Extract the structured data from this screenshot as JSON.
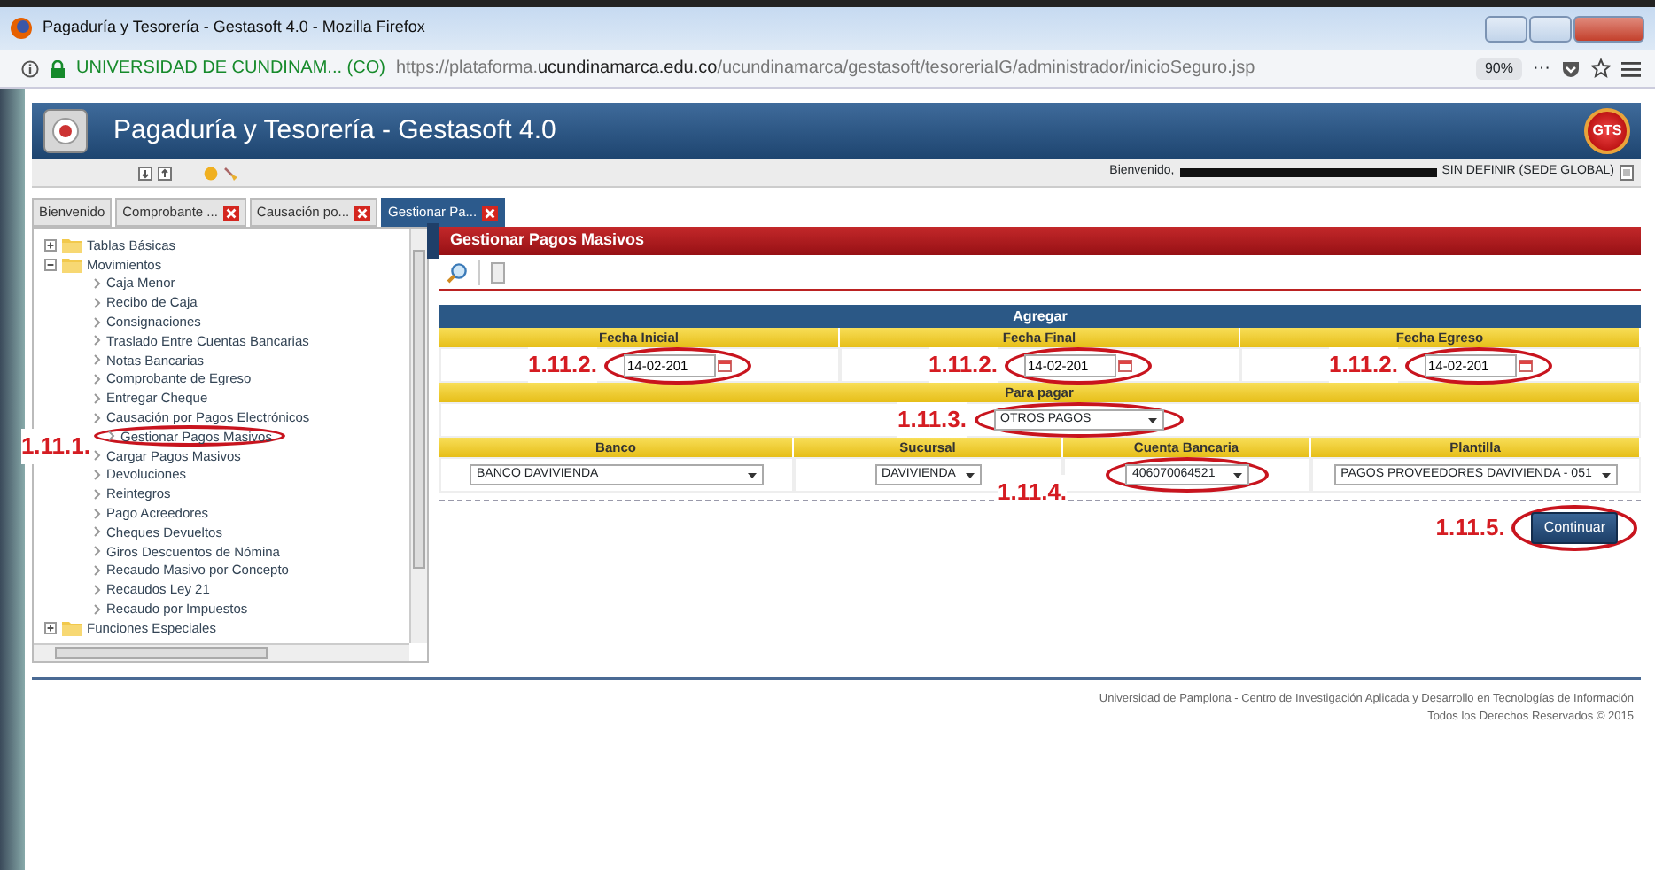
{
  "browser": {
    "title": "Pagaduría y Tesorería - Gestasoft 4.0 - Mozilla Firefox",
    "site_identity": "UNIVERSIDAD DE CUNDINAM... (CO)",
    "url": "https://plataforma.**ucundinamarca.edu.co**/ucundinamarca/gestasoft/tesoreriaIG/administrador/inicioSeguro.jsp",
    "zoom": "90%",
    "more": "···"
  },
  "app": {
    "title": "Pagaduría y Tesorería - Gestasoft 4.0",
    "logo": "GTS",
    "welcome": "Bienvenido,",
    "role": "SIN DEFINIR (SEDE GLOBAL)"
  },
  "tabs": [
    {
      "label": "Bienvenido",
      "closable": false,
      "selected": false
    },
    {
      "label": "Comprobante ...",
      "closable": true,
      "selected": false
    },
    {
      "label": "Causación po...",
      "closable": true,
      "selected": false
    },
    {
      "label": "Gestionar Pa...",
      "closable": true,
      "selected": true
    }
  ],
  "tree": [
    {
      "label": "Tablas Básicas",
      "expanded": false
    },
    {
      "label": "Movimientos",
      "expanded": true,
      "children": [
        {
          "label": "Caja Menor"
        },
        {
          "label": "Recibo de Caja"
        },
        {
          "label": "Consignaciones"
        },
        {
          "label": "Traslado Entre Cuentas Bancarias"
        },
        {
          "label": "Notas Bancarias"
        },
        {
          "label": "Comprobante de Egreso"
        },
        {
          "label": "Entregar Cheque"
        },
        {
          "label": "Causación por Pagos Electrónicos"
        },
        {
          "label": "Gestionar Pagos Masivos",
          "annotation": "1.11.1.",
          "circled": true
        },
        {
          "label": "Cargar Pagos Masivos"
        },
        {
          "label": "Devoluciones"
        },
        {
          "label": "Reintegros"
        },
        {
          "label": "Pago Acreedores"
        },
        {
          "label": "Cheques Devueltos"
        },
        {
          "label": "Giros Descuentos de Nómina"
        },
        {
          "label": "Recaudo Masivo por Concepto"
        },
        {
          "label": "Recaudos Ley 21"
        },
        {
          "label": "Recaudo por Impuestos"
        }
      ]
    },
    {
      "label": "Funciones Especiales",
      "expanded": false
    }
  ],
  "panel": {
    "title": "Gestionar Pagos Masivos",
    "section": "Agregar",
    "dates": [
      {
        "label": "Fecha Inicial",
        "value": "14-02-201",
        "annotation": "1.11.2.",
        "circled": true
      },
      {
        "label": "Fecha Final",
        "value": "14-02-201",
        "annotation": "1.11.2.",
        "circled": true
      },
      {
        "label": "Fecha Egreso",
        "value": "14-02-201",
        "annotation": "1.11.2.",
        "circled": true
      }
    ],
    "payment": {
      "label": "Para pagar",
      "value": "OTROS PAGOS",
      "annotation": "1.11.3.",
      "circled": true
    },
    "selects": [
      {
        "label": "Banco",
        "value": "BANCO DAVIVIENDA"
      },
      {
        "label": "Sucursal",
        "value": "DAVIVIENDA"
      },
      {
        "label": "Cuenta Bancaria",
        "value": "406070064521",
        "annotation": "1.11.4.",
        "circled": true
      },
      {
        "label": "Plantilla",
        "value": "PAGOS PROVEEDORES DAVIVIENDA - 051"
      }
    ],
    "button": {
      "label": "Continuar",
      "annotation": "1.11.5.",
      "circled": true
    }
  },
  "footer": [
    "Universidad de Pamplona - Centro de Investigación Aplicada y Desarrollo en Tecnologías de Información",
    "Todos los Derechos Reservados © 2015"
  ]
}
